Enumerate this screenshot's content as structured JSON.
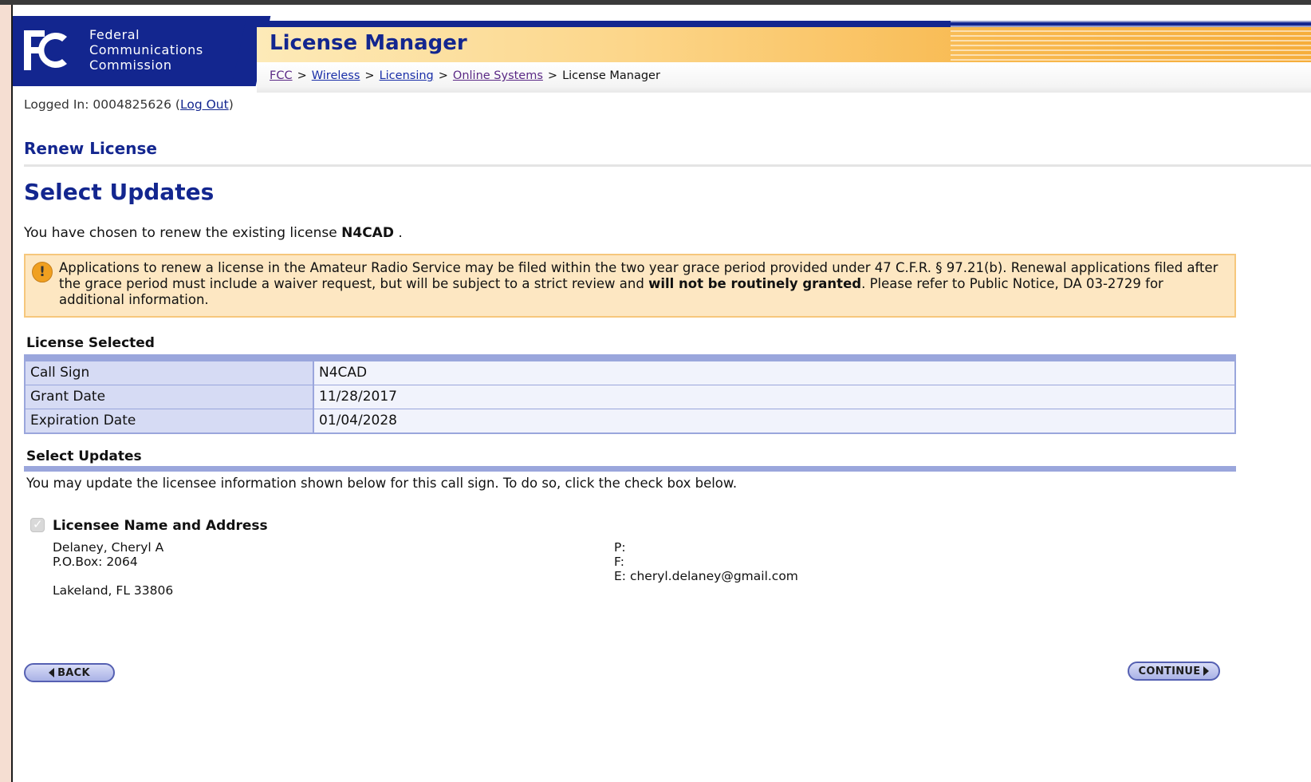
{
  "header": {
    "agency_lines": [
      "Federal",
      "Communications",
      "Commission"
    ],
    "app_title": "License Manager",
    "breadcrumbs": [
      "FCC",
      "Wireless",
      "Licensing",
      "Online Systems"
    ],
    "breadcrumb_current": "License Manager",
    "breadcrumb_sep": ">"
  },
  "session": {
    "logged_in_label": "Logged In: 0004825626 (",
    "logout_link": "Log Out",
    "logged_in_close": ")"
  },
  "page": {
    "section_title": "Renew License",
    "title": "Select Updates",
    "intro_prefix": "You have chosen to renew the existing license ",
    "intro_call_sign": "N4CAD",
    "intro_suffix": " ."
  },
  "alert": {
    "icon": "exclamation-icon",
    "text_before": "Applications to renew a license in the Amateur Radio Service may be filed within the two year grace period provided under 47 C.F.R. § 97.21(b). Renewal applications filed after the grace period must include a waiver request, but will be subject to a strict review and ",
    "text_bold": "will not be routinely granted",
    "text_after": ". Please refer to Public Notice, DA 03-2729 for additional information."
  },
  "license_selected": {
    "heading": "License Selected",
    "rows": [
      {
        "label": "Call Sign",
        "value": "N4CAD"
      },
      {
        "label": "Grant Date",
        "value": "11/28/2017"
      },
      {
        "label": "Expiration Date",
        "value": "01/04/2028"
      }
    ]
  },
  "select_updates": {
    "heading": "Select Updates",
    "note": "You may update the licensee information shown below for this call sign. To do so, click the check box below.",
    "checkbox_label": "Licensee Name and Address",
    "checkbox_checked": true,
    "address_lines": [
      "Delaney, Cheryl A",
      "P.O.Box: 2064",
      "",
      "Lakeland, FL 33806"
    ],
    "phone_label": "P:",
    "phone": "",
    "fax_label": "F:",
    "fax": "",
    "email_label": "E:",
    "email": "cheryl.delaney@gmail.com"
  },
  "buttons": {
    "back": "BACK",
    "continue": "CONTINUE"
  },
  "colors": {
    "fcc_blue": "#13268f",
    "table_border": "#9aa6dc",
    "alert_bg": "#fde7c2"
  }
}
